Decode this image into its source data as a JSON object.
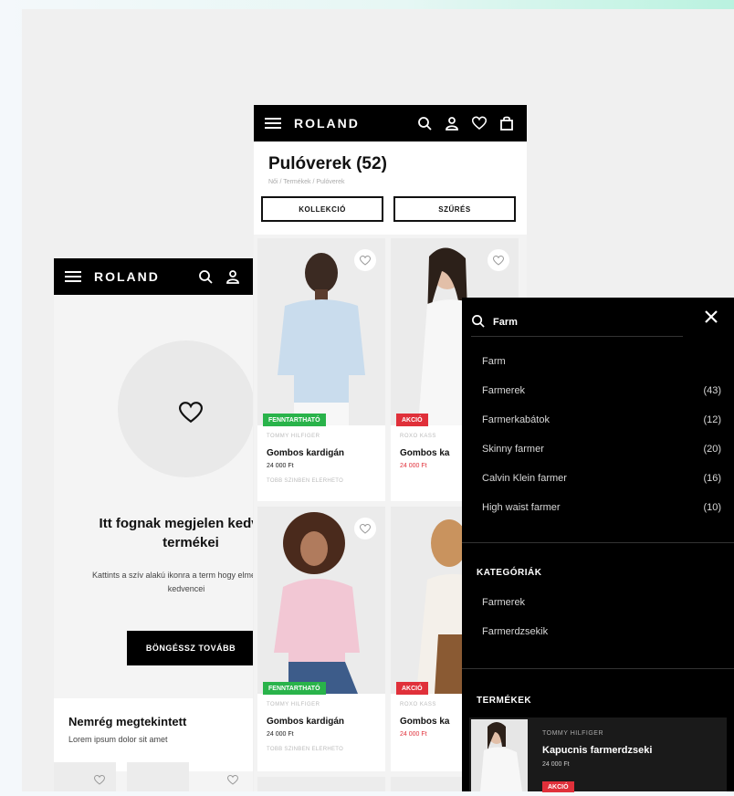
{
  "brand": "ROLAND",
  "colors": {
    "badge_green": "#29b34a",
    "badge_red": "#e0303a",
    "nav_bg": "#000000",
    "accent_gradient": "#b9f2df"
  },
  "wishlist": {
    "empty_title": "Itt fognak megjelen kedvenc termékei",
    "empty_text": "Kattints a szív alakú ikonra a term hogy elmenthesd kedvencei",
    "browse_button": "BÖNGÉSSZ TOVÁBB",
    "recent_title": "Nemrég megtekintett",
    "recent_sub": "Lorem ipsum dolor sit amet"
  },
  "listing": {
    "title": "Pulóverek (52)",
    "breadcrumb": "Női / Termékek / Pulóverek",
    "collection_button": "KOLLEKCIÓ",
    "filter_button": "SZŰRÉS",
    "products": [
      {
        "badge": "FENNTARTHATÓ",
        "brand": "TOMMY HILFIGER",
        "name": "Gombos kardigán",
        "price": "24 000 Ft",
        "colors": "TOBB SZINBEN ELERHETO"
      },
      {
        "badge": "AKCIÓ",
        "brand": "ROXO KASS",
        "name": "Gombos ka",
        "price": "24 000 Ft",
        "colors": ""
      },
      {
        "badge": "FENNTARTHATÓ",
        "brand": "TOMMY HILFIGER",
        "name": "Gombos kardigán",
        "price": "24 000 Ft",
        "colors": "TOBB SZINBEN ELERHETO"
      },
      {
        "badge": "AKCIÓ",
        "brand": "ROXO KASS",
        "name": "Gombos ka",
        "price": "24 000 Ft",
        "colors": ""
      }
    ]
  },
  "search": {
    "query": "Farm",
    "suggestions": [
      {
        "label": "Farm",
        "count": ""
      },
      {
        "label": "Farmerek",
        "count": "(43)"
      },
      {
        "label": "Farmerkabátok",
        "count": "(12)"
      },
      {
        "label": "Skinny farmer",
        "count": "(20)"
      },
      {
        "label": "Calvin Klein farmer",
        "count": "(16)"
      },
      {
        "label": "High waist farmer",
        "count": "(10)"
      }
    ],
    "categories_title": "KATEGÓRIÁK",
    "categories": [
      "Farmerek",
      "Farmerdzsekik"
    ],
    "products_title": "TERMÉKEK",
    "product": {
      "brand": "TOMMY HILFIGER",
      "name": "Kapucnis farmerdzseki",
      "price": "24 000 Ft",
      "badge": "AKCIÓ"
    }
  },
  "icons": [
    "menu-icon",
    "search-icon",
    "user-icon",
    "heart-icon",
    "bag-icon",
    "close-icon"
  ]
}
